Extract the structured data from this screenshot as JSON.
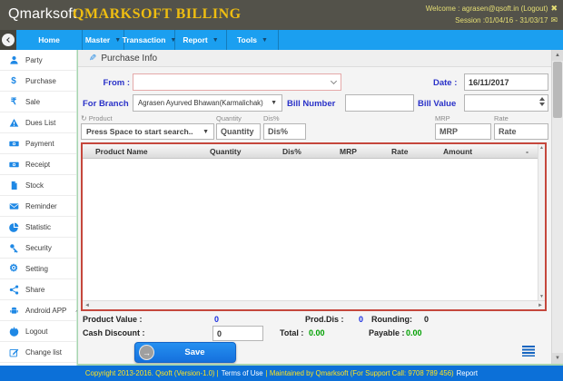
{
  "header": {
    "logo": "Qmarksoft",
    "title": "QMARKSOFT BILLING",
    "welcome": "Welcome : agrasen@qsoft.in (Logout)",
    "session": "Session :01/04/16 - 31/03/17",
    "close_icon": "close-icon",
    "mail_icon": "envelope-icon"
  },
  "nav": {
    "items": [
      {
        "label": "Home"
      },
      {
        "label": "Master"
      },
      {
        "label": "Transaction"
      },
      {
        "label": "Report"
      },
      {
        "label": "Tools"
      }
    ]
  },
  "sidebar": {
    "items": [
      {
        "label": "Party",
        "icon": "user-icon"
      },
      {
        "label": "Purchase",
        "icon": "dollar-icon"
      },
      {
        "label": "Sale",
        "icon": "rupee-icon"
      },
      {
        "label": "Dues List",
        "icon": "warning-icon"
      },
      {
        "label": "Payment",
        "icon": "money-icon"
      },
      {
        "label": "Receipt",
        "icon": "money-icon"
      },
      {
        "label": "Stock",
        "icon": "file-icon"
      },
      {
        "label": "Reminder",
        "icon": "envelope-icon"
      },
      {
        "label": "Statistic",
        "icon": "pie-chart-icon"
      },
      {
        "label": "Security",
        "icon": "key-icon"
      },
      {
        "label": "Setting",
        "icon": "gear-icon"
      },
      {
        "label": "Share",
        "icon": "share-icon"
      },
      {
        "label": "Android APP",
        "icon": "android-icon"
      },
      {
        "label": "Logout",
        "icon": "power-icon"
      },
      {
        "label": "Change list",
        "icon": "edit-icon"
      }
    ],
    "glyphs": {
      "dollar": "$",
      "rupee": "₹",
      "gear": "⚙"
    }
  },
  "main": {
    "page_title": "Purchase Info",
    "form": {
      "from_label": "From :",
      "from_value": "",
      "date_label": "Date :",
      "date_value": "16/11/2017",
      "branch_label": "For Branch",
      "branch_value": "Agrasen Ayurved Bhawan(Karmalichak)",
      "bill_number_label": "Bill Number",
      "bill_number_value": "",
      "bill_value_label": "Bill Value",
      "bill_value_value": "",
      "product_label": "Product",
      "quantity_label": "Quantity",
      "dis_label": "Dis%",
      "mrp_label": "MRP",
      "rate_label": "Rate",
      "product_placeholder": "Press Space to start search..",
      "quantity_placeholder": "Quantity",
      "dis_placeholder": "Dis%",
      "mrp_placeholder": "MRP",
      "rate_placeholder": "Rate"
    },
    "table": {
      "headers": [
        "Product Name",
        "Quantity",
        "Dis%",
        "MRP",
        "Rate",
        "Amount",
        "-"
      ],
      "rows": []
    },
    "totals": {
      "product_value_label": "Product Value :",
      "product_value": "0",
      "prod_dis_label": "Prod.Dis :",
      "prod_dis": "0",
      "rounding_label": "Rounding:",
      "rounding": "0",
      "cash_discount_label": "Cash Discount :",
      "cash_discount_value": "0",
      "total_label": "Total :",
      "total_value": "0.00",
      "payable_label": "Payable :",
      "payable_value": "0.00",
      "save_label": "Save"
    }
  },
  "footer": {
    "copyright": "Copyright 2013-2016. Qsoft (Version-1.0) |",
    "terms": "Terms of Use",
    "maintained": "| Maintained by Qmarksoft (For Support Call: 9708 789 456)",
    "report": "Report"
  },
  "colors": {
    "header_bg": "#53524a",
    "brand_gold": "#eebd11",
    "welcome_yellow": "#e6df74",
    "nav_blue": "#1b9ff0",
    "icon_blue": "#1e88e5",
    "label_blue": "#2a32c8",
    "value_blue": "#1b2ee0",
    "value_green": "#00a000",
    "grid_border_red": "#c5473c",
    "footer_blue": "#0c70d8",
    "footer_yellow": "#ffe41e"
  }
}
